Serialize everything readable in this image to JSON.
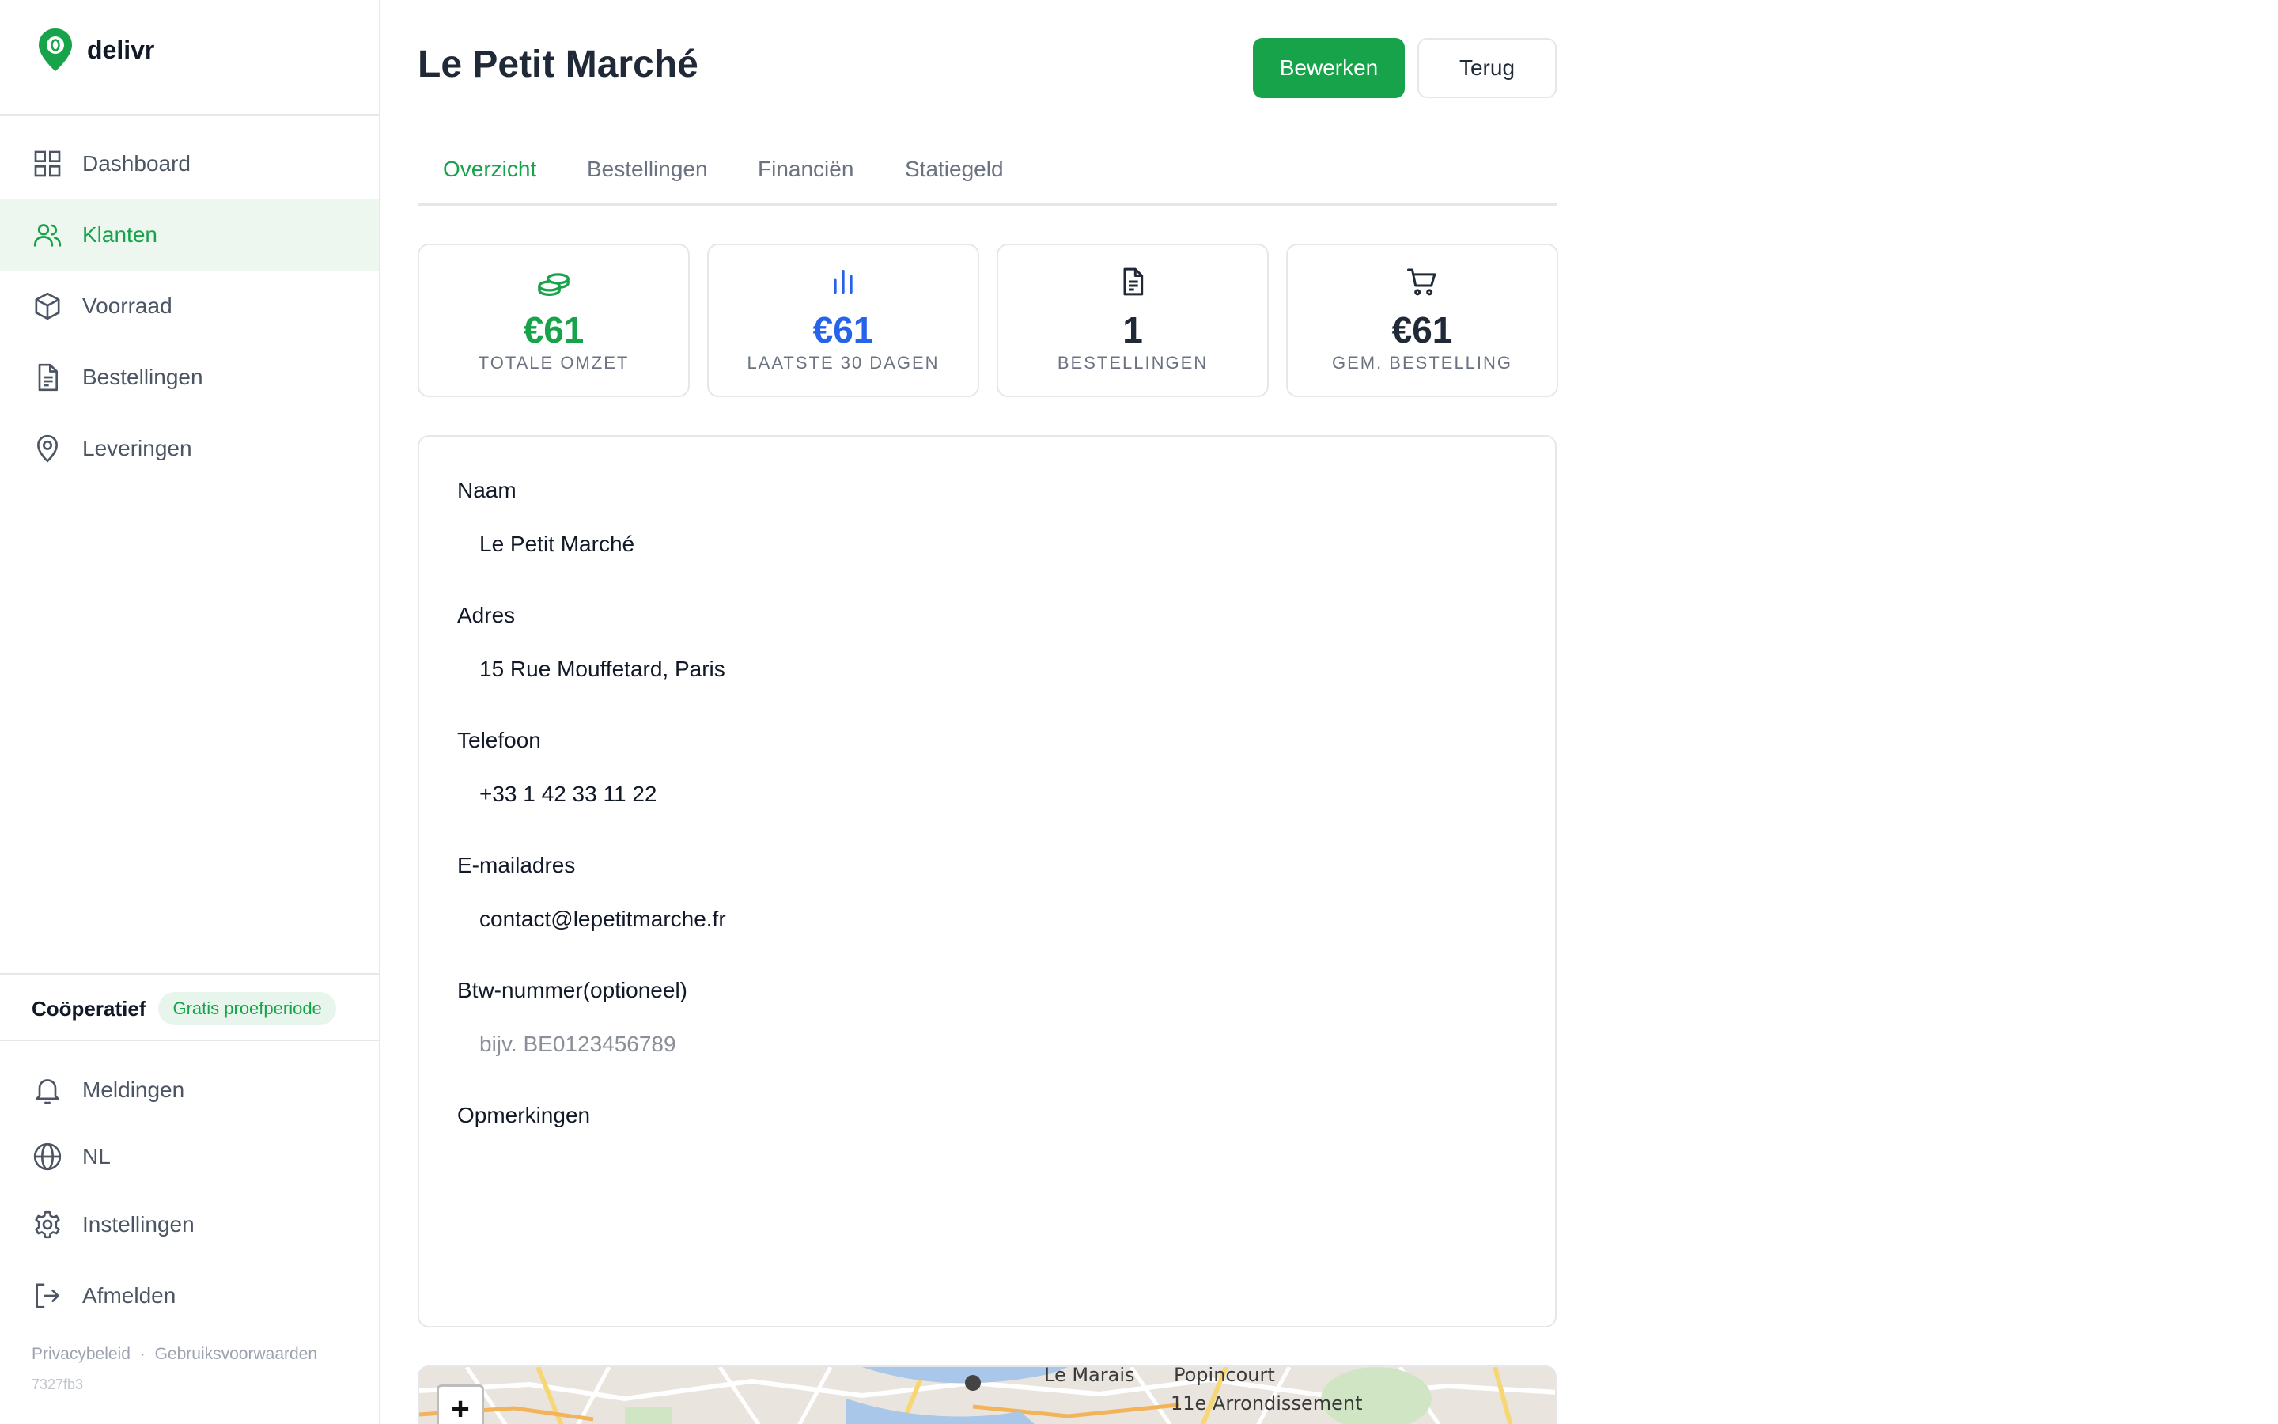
{
  "brand": {
    "name": "delivr",
    "accent": "#16a34a"
  },
  "sidebar": {
    "items": [
      {
        "label": "Dashboard",
        "icon": "grid-icon"
      },
      {
        "label": "Klanten",
        "icon": "users-icon",
        "active": true
      },
      {
        "label": "Voorraad",
        "icon": "box-icon"
      },
      {
        "label": "Bestellingen",
        "icon": "document-icon"
      },
      {
        "label": "Leveringen",
        "icon": "map-pin-icon"
      }
    ],
    "org": {
      "name": "Coöperatief",
      "badge": "Gratis proefperiode"
    },
    "bottom_items": [
      {
        "label": "Meldingen",
        "icon": "bell-icon"
      },
      {
        "label": "NL",
        "icon": "globe-icon"
      },
      {
        "label": "Instellingen",
        "icon": "gear-icon"
      },
      {
        "label": "Afmelden",
        "icon": "logout-icon"
      }
    ],
    "footer": {
      "privacy": "Privacybeleid",
      "separator": "·",
      "terms": "Gebruiksvoorwaarden",
      "version": "7327fb3"
    }
  },
  "header": {
    "title": "Le Petit Marché",
    "edit_label": "Bewerken",
    "back_label": "Terug"
  },
  "tabs": [
    {
      "label": "Overzicht",
      "active": true
    },
    {
      "label": "Bestellingen"
    },
    {
      "label": "Financiën"
    },
    {
      "label": "Statiegeld"
    }
  ],
  "stats": [
    {
      "value": "€61",
      "caption": "TOTALE OMZET",
      "icon": "coins-icon",
      "color": "#16a34a"
    },
    {
      "value": "€61",
      "caption": "LAATSTE 30 DAGEN",
      "icon": "bar-chart-icon",
      "color": "#2563eb"
    },
    {
      "value": "1",
      "caption": "BESTELLINGEN",
      "icon": "document-icon",
      "color": "#1f2937"
    },
    {
      "value": "€61",
      "caption": "GEM. BESTELLING",
      "icon": "cart-icon",
      "color": "#1f2937"
    }
  ],
  "details": {
    "name_label": "Naam",
    "name_value": "Le Petit Marché",
    "address_label": "Adres",
    "address_value": "15 Rue Mouffetard, Paris",
    "phone_label": "Telefoon",
    "phone_value": "+33 1 42 33 11 22",
    "email_label": "E-mailadres",
    "email_value": "contact@lepetitmarche.fr",
    "vat_label": "Btw-nummer(optioneel)",
    "vat_placeholder": "bijv. BE0123456789",
    "notes_label": "Opmerkingen"
  },
  "map": {
    "zoom_in": "+",
    "labels": [
      "Le Marais",
      "Popincourt",
      "11e Arrondissement"
    ]
  }
}
